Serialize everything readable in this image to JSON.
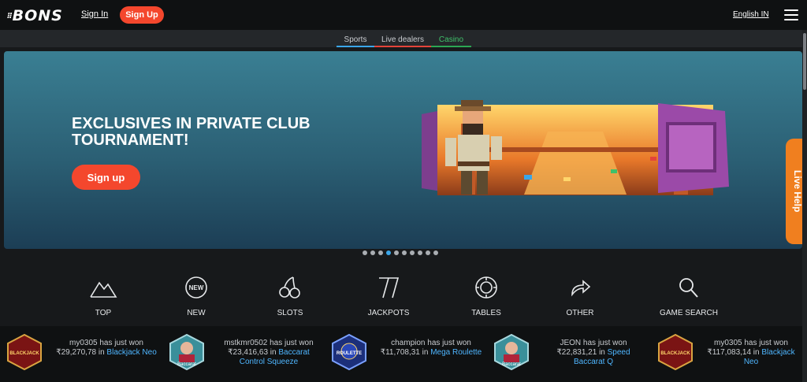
{
  "header": {
    "logo": "BONS",
    "signin": "Sign In",
    "signup": "Sign Up",
    "language": "English IN"
  },
  "subnav": {
    "tabs": [
      "Sports",
      "Live dealers",
      "Casino"
    ],
    "active": "Casino"
  },
  "hero": {
    "title": "EXCLUSIVES IN PRIVATE CLUB TOURNAMENT!",
    "button": "Sign up",
    "slides_count": 10,
    "active_slide": 4
  },
  "live_help": "Live Help",
  "categories": [
    {
      "label": "TOP",
      "icon": "mountain-icon"
    },
    {
      "label": "NEW",
      "icon": "new-badge-icon"
    },
    {
      "label": "SLOTS",
      "icon": "cherries-icon"
    },
    {
      "label": "JACKPOTS",
      "icon": "sevens-icon"
    },
    {
      "label": "TABLES",
      "icon": "chip-icon"
    },
    {
      "label": "OTHER",
      "icon": "share-arrow-icon"
    },
    {
      "label": "GAME SEARCH",
      "icon": "search-icon"
    }
  ],
  "wins": [
    {
      "user": "my0305 has just won",
      "amount": "₹29,270,78 in",
      "game": "Blackjack Neo",
      "badge": "BLACKJACK"
    },
    {
      "user": "mstkmr0502 has just won",
      "amount": "₹23,416,63 in",
      "game": "Baccarat Control Squeeze",
      "badge": "Baccarat"
    },
    {
      "user": "champion has just won",
      "amount": "₹11,708,31 in",
      "game": "Mega Roulette",
      "badge": "ROULETTE"
    },
    {
      "user": "JEON has just won",
      "amount": "₹22,831,21 in",
      "game": "Speed Baccarat Q",
      "badge": "Baccarat"
    },
    {
      "user": "my0305 has just won",
      "amount": "₹117,083,14 in",
      "game": "Blackjack Neo",
      "badge": "BLACKJACK"
    }
  ],
  "colors": {
    "accent": "#f4472d",
    "sports": "#3aa6e9",
    "live": "#e3443a",
    "casino": "#2ca653",
    "live_help": "#f07f1f",
    "game_link": "#4fb6ff"
  }
}
